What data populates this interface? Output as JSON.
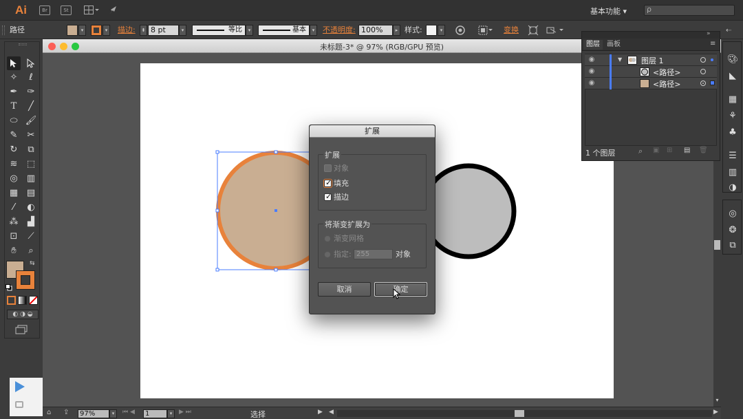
{
  "app": {
    "logo": "Ai",
    "menubar_icons": [
      "Br",
      "St",
      "arrange-documents-icon",
      "gpu-rocket-icon"
    ],
    "workspace_label": "基本功能 ▾",
    "search_placeholder": "ρ"
  },
  "controlbar": {
    "object_type": "路径",
    "fill_color": "#c9ae92",
    "stroke_color": "#e8823b",
    "stroke_label": "描边:",
    "stroke_weight": "8 pt",
    "profile_label": "等比",
    "brush_label": "基本",
    "opacity_label": "不透明度:",
    "opacity_value": "100%",
    "style_label": "样式:",
    "transform_label": "变换"
  },
  "document": {
    "title": "未标题-3* @ 97% (RGB/GPU 预览)",
    "zoom": "97%",
    "artboard_number": "1",
    "status_label": "选择"
  },
  "artwork": {
    "left_circle_fill": "#c9ae92",
    "left_circle_stroke": "#e8823b",
    "right_circle_fill": "#bdbdbd",
    "right_circle_stroke": "#000000"
  },
  "dialog": {
    "title": "扩展",
    "group1_title": "扩展",
    "options": [
      {
        "label": "对象",
        "checked": false,
        "disabled": true
      },
      {
        "label": "填充",
        "checked": true,
        "disabled": false
      },
      {
        "label": "描边",
        "checked": true,
        "disabled": false
      }
    ],
    "group2_title": "将渐变扩展为",
    "radio_gradient_mesh": "渐变网格",
    "radio_specify": "指定:",
    "specify_value": "255",
    "specify_unit": "对象",
    "cancel_label": "取消",
    "ok_label": "确定"
  },
  "layers_panel": {
    "tabs": [
      "图层",
      "画板"
    ],
    "layers": [
      {
        "name": "图层 1",
        "level": 0
      },
      {
        "name": "<路径>",
        "level": 1
      },
      {
        "name": "<路径>",
        "level": 1
      }
    ],
    "layer_count": "1 个图层"
  },
  "toolbar": {
    "fill_color": "#c9ae92",
    "stroke_color": "#e8823b"
  }
}
